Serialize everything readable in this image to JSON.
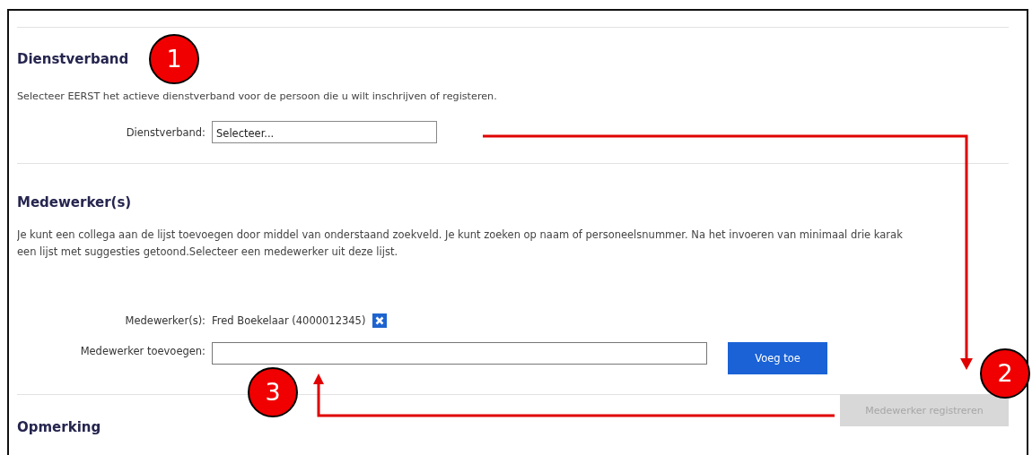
{
  "sections": [
    {
      "kind": "employment",
      "heading": "Dienstverband",
      "intro": [
        "Selecteer EERST het actieve dienstverband voor de persoon die u wilt inschrijven of registeren."
      ],
      "fields": [
        {
          "kind": "select",
          "label": "Dienstverband:",
          "value": "Selecteer..."
        }
      ]
    },
    {
      "kind": "employees",
      "heading": "Medewerker(s)",
      "intro": [
        "Je kunt een collega aan de lijst toevoegen door middel van onderstaand zoekveld. Je kunt zoeken op naam of personeelsnummer. Na het invoeren van minimaal drie karak",
        "een lijst met suggesties getoond.Selecteer een medewerker uit deze lijst."
      ],
      "fields": [
        {
          "kind": "list",
          "label": "Medewerker(s):",
          "value": "Fred Boekelaar (4000012345)"
        },
        {
          "kind": "search",
          "label": "Medewerker toevoegen:",
          "button": "Voeg toe"
        }
      ]
    },
    {
      "kind": "remark",
      "heading": "Opmerking",
      "button": {
        "label": "Medewerker registreren",
        "disabled": true
      }
    }
  ],
  "callouts": [
    "1",
    "2",
    "3"
  ]
}
